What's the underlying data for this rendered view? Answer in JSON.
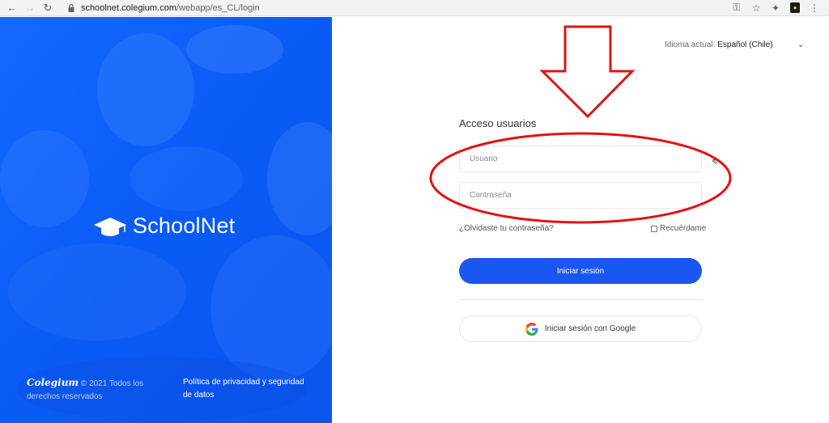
{
  "browser": {
    "url_host": "schoolnet.colegium.com",
    "url_path": "/webapp/es_CL/login",
    "extension_badge": "●"
  },
  "hero": {
    "brand_name": "SchoolNet",
    "footer_brand": "Colegium",
    "footer_copyright": "© 2021   Todos los derechos reservados",
    "privacy_link": "Política de privacidad y seguridad de datos"
  },
  "language": {
    "label": "Idioma actual:",
    "value": "Español (Chile)"
  },
  "form": {
    "title": "Acceso usuarios",
    "username_placeholder": "Usuario",
    "password_placeholder": "Contraseña",
    "forgot_link": "¿Olvidaste tu contraseña?",
    "remember_label": "Recuérdame",
    "login_button": "Iniciar sesión",
    "google_button": "Iniciar sesión con Google"
  },
  "colors": {
    "brand_blue": "#0b5fff",
    "button_blue": "#1a56f0",
    "annotation_red": "#e01414"
  },
  "icons": {
    "back": "arrow-left-icon",
    "forward": "arrow-right-icon",
    "reload": "reload-icon",
    "lock": "lock-icon",
    "key": "key-icon",
    "star": "star-icon",
    "extensions": "puzzle-icon",
    "menu": "kebab-menu-icon",
    "brand": "graduation-cap-icon",
    "google": "google-icon",
    "chevron": "chevron-down-icon"
  }
}
